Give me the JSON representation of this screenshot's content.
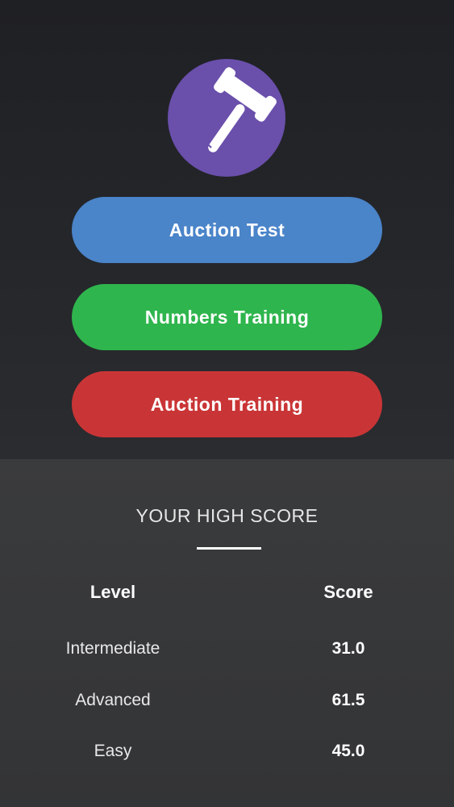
{
  "colors": {
    "top_background": "#222327",
    "bottom_background": "#37383a",
    "logo_circle": "#6a4fab",
    "auction_test": "#4a84c9",
    "numbers_training": "#2fb54d",
    "auction_training": "#c93536"
  },
  "logo": {
    "icon": "gavel-icon"
  },
  "menu": {
    "auction_test": "Auction Test",
    "numbers_training": "Numbers Training",
    "auction_training": "Auction Training"
  },
  "high_score": {
    "title": "YOUR HIGH SCORE",
    "headers": {
      "level": "Level",
      "score": "Score"
    },
    "rows": [
      {
        "level": "Intermediate",
        "score": "31.0"
      },
      {
        "level": "Advanced",
        "score": "61.5"
      },
      {
        "level": "Easy",
        "score": "45.0"
      }
    ]
  }
}
